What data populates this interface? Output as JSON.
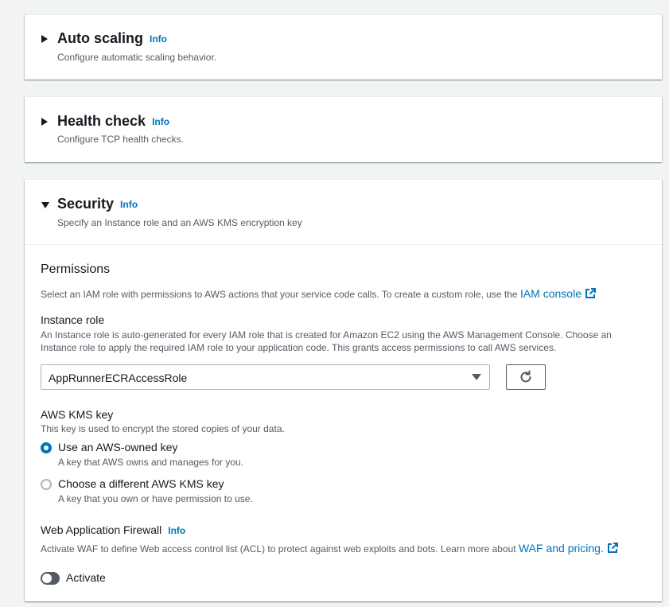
{
  "auto_scaling": {
    "title": "Auto scaling",
    "info": "Info",
    "description": "Configure automatic scaling behavior."
  },
  "health_check": {
    "title": "Health check",
    "info": "Info",
    "description": "Configure TCP health checks."
  },
  "security": {
    "title": "Security",
    "info": "Info",
    "description": "Specify an Instance role and an AWS KMS encryption key",
    "permissions": {
      "heading": "Permissions",
      "text": "Select an IAM role with permissions to AWS actions that your service code calls. To create a custom role, use the",
      "link": "IAM console"
    },
    "instance_role": {
      "label": "Instance role",
      "description_line1": "An Instance role is auto-generated for every IAM role that is created for Amazon EC2 using the AWS Management Console. Choose an",
      "description_line2": "Instance role to apply the required IAM role to your application code. This grants access permissions to call AWS services.",
      "selected": "AppRunnerECRAccessRole"
    },
    "kms": {
      "label": "AWS KMS key",
      "description": "This key is used to encrypt the stored copies of your data.",
      "options": [
        {
          "label": "Use an AWS-owned key",
          "description": "A key that AWS owns and manages for you.",
          "checked": true
        },
        {
          "label": "Choose a different AWS KMS key",
          "description": "A key that you own or have permission to use.",
          "checked": false
        }
      ]
    },
    "waf": {
      "label": "Web Application Firewall",
      "info": "Info",
      "text": "Activate WAF to define Web access control list (ACL) to protect against web exploits and bots. Learn more about",
      "link": "WAF and pricing.",
      "toggle_label": "Activate",
      "toggle_on": false
    }
  },
  "colors": {
    "link": "#0073bb",
    "text": "#16191f",
    "muted": "#545b64",
    "background": "#f2f3f3"
  }
}
